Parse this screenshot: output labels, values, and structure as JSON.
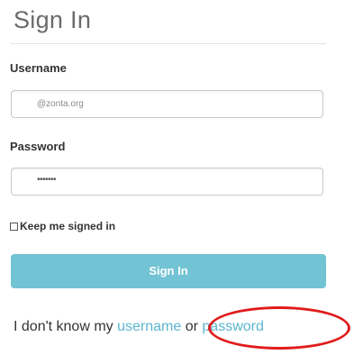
{
  "header": {
    "title": "Sign In"
  },
  "form": {
    "username_label": "Username",
    "username_value": "@zonta.org",
    "password_label": "Password",
    "password_value": "•••••••",
    "keep_signed_in_label": "Keep me signed in",
    "keep_signed_in_checked": false,
    "submit_label": "Sign In"
  },
  "forgot": {
    "prefix": "I don't know my ",
    "username_link": "username",
    "connector": " or ",
    "password_link": "password"
  },
  "colors": {
    "button": "#72c3d4",
    "link": "#5bb6d0",
    "annotation": "#e11b1b"
  }
}
